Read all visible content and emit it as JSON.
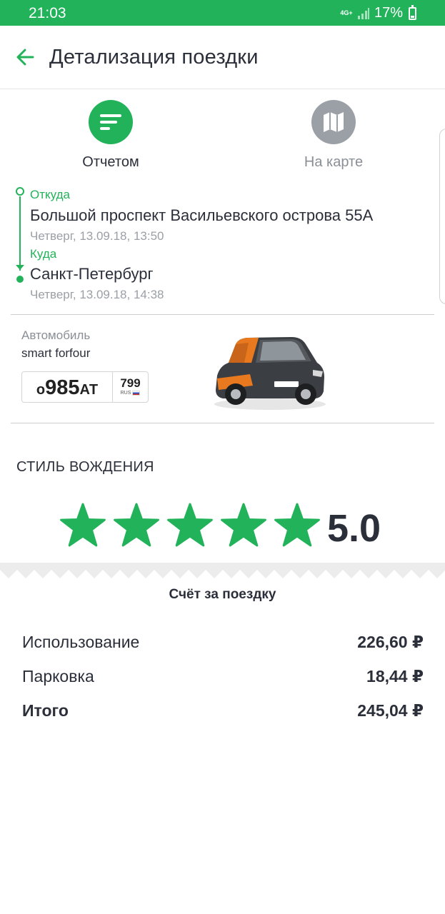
{
  "status_bar": {
    "time": "21:03",
    "network": "4G+",
    "battery": "17%"
  },
  "header": {
    "title": "Детализация поездки"
  },
  "view_tabs": {
    "report": "Отчетом",
    "map": "На карте"
  },
  "route": {
    "from_label": "Откуда",
    "from_address": "Большой проспект Васильевского острова 55А",
    "from_time": "Четверг, 13.09.18, 13:50",
    "to_label": "Куда",
    "to_address": "Санкт-Петербург",
    "to_time": "Четверг, 13.09.18, 14:38"
  },
  "car": {
    "caption": "Автомобиль",
    "model": "smart forfour",
    "plate": {
      "letter1": "о",
      "digits": "985",
      "letters2": "АТ",
      "region": "799",
      "country": "RUS"
    }
  },
  "driving_style": {
    "title": "СТИЛЬ ВОЖДЕНИЯ",
    "rating": "5.0",
    "stars": 5,
    "star_color": "#22b35a"
  },
  "bill": {
    "title": "Счёт за поездку",
    "rows": [
      {
        "label": "Использование",
        "amount": "226,60 ₽"
      },
      {
        "label": "Парковка",
        "amount": "18,44 ₽"
      },
      {
        "label": "Итого",
        "amount": "245,04 ₽"
      }
    ]
  },
  "colors": {
    "accent": "#22b35a",
    "text": "#2b2f3a",
    "muted": "#9aa0a6"
  }
}
